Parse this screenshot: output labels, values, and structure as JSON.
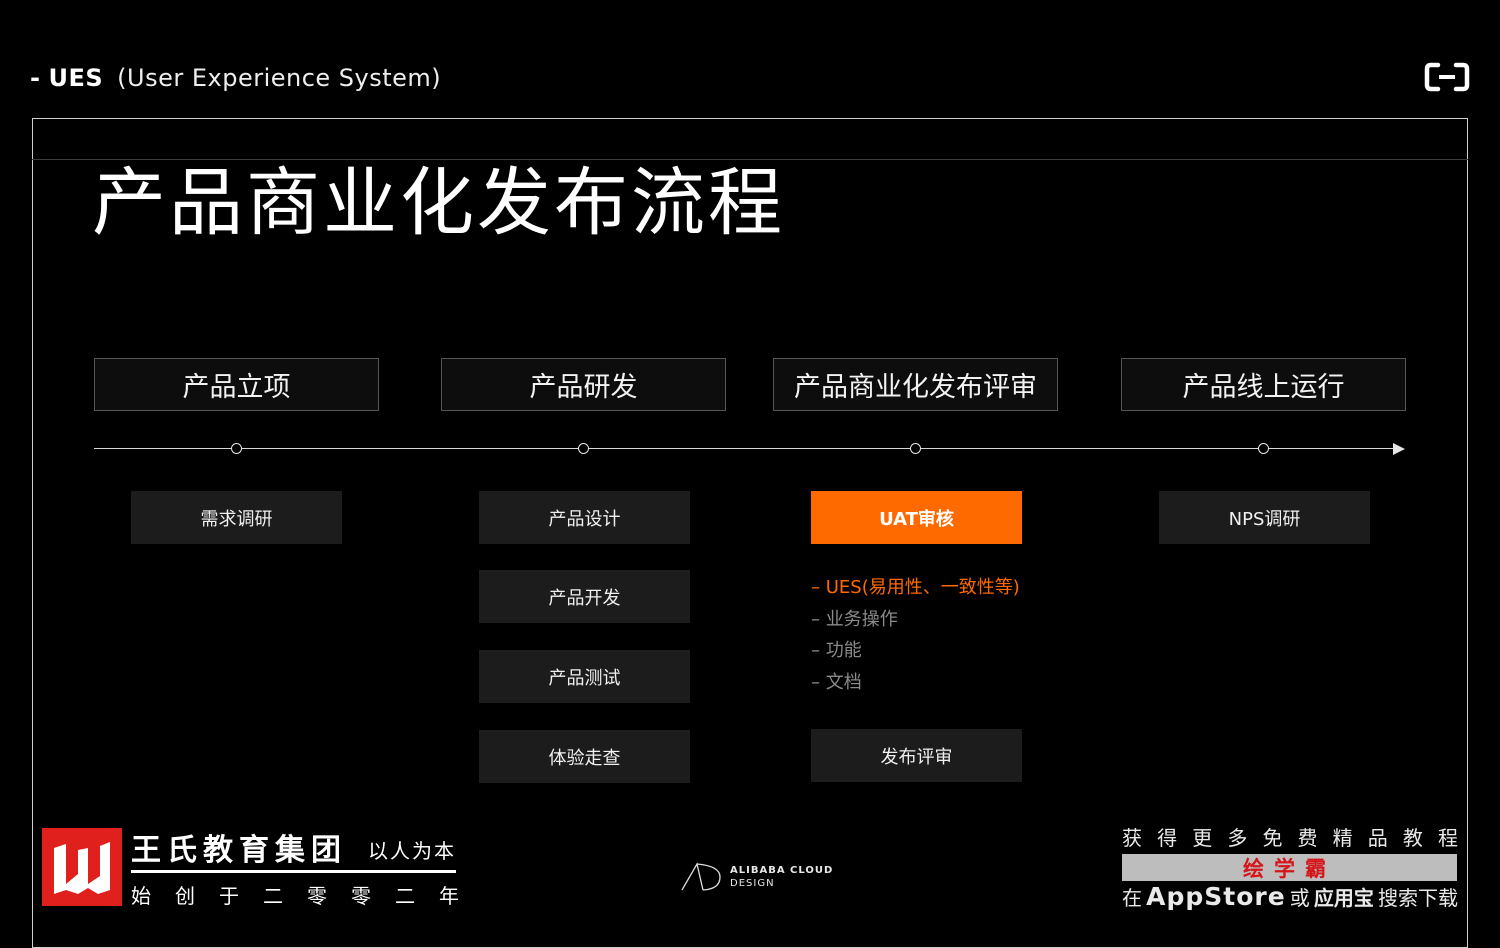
{
  "header": {
    "dash": "-",
    "title": "UES",
    "subtitle": "(User Experience System)"
  },
  "page_title": "产品商业化发布流程",
  "stages": [
    {
      "label": "产品立项"
    },
    {
      "label": "产品研发"
    },
    {
      "label": "产品商业化发布评审"
    },
    {
      "label": "产品线上运行"
    }
  ],
  "steps": {
    "initiation": [
      "需求调研"
    ],
    "development": [
      "产品设计",
      "产品开发",
      "产品测试",
      "体验走查"
    ],
    "review_active": "UAT审核",
    "review_checklist": [
      "– UES(易用性、一致性等)",
      "– 业务操作",
      "– 功能",
      "– 文档"
    ],
    "review_final": "发布评审",
    "operation": [
      "NPS调研"
    ]
  },
  "colors": {
    "accent": "#ff6a00",
    "step_bg": "#1c1c1c",
    "wang_red": "#e0201c"
  },
  "footer": {
    "wang": {
      "title": "王氏教育集团",
      "slogan": "以人为本",
      "founded": [
        "始",
        "创",
        "于",
        "二",
        "零",
        "零",
        "二",
        "年"
      ]
    },
    "alibaba": {
      "line1": "ALIBABA CLOUD",
      "line2": "DESIGN"
    },
    "promo": {
      "top": [
        "获",
        "得",
        "更",
        "多",
        "免",
        "费",
        "精",
        "品",
        "教",
        "程"
      ],
      "brand": "绘学霸",
      "bottom_prefix": "在",
      "bottom_store": "AppStore",
      "bottom_or": "或",
      "bottom_app": "应用宝",
      "bottom_suffix": "搜索下载"
    }
  }
}
